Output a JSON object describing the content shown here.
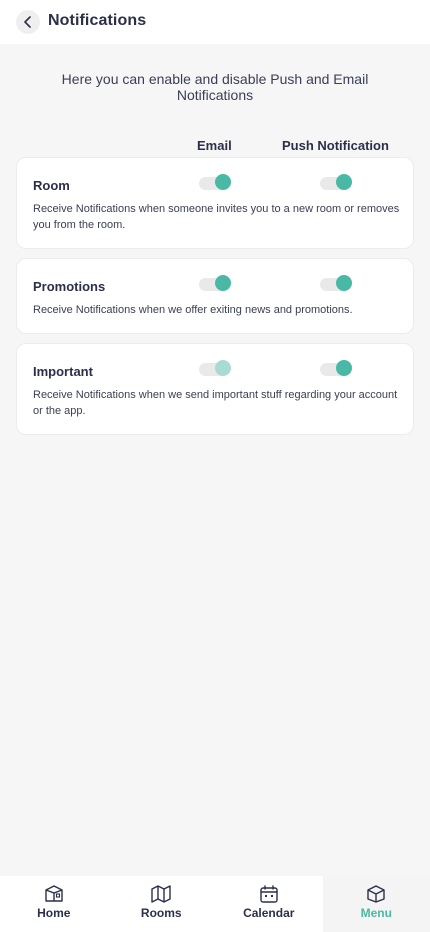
{
  "header": {
    "title": "Notifications",
    "back_icon": "chevron-left-icon"
  },
  "intro": "Here you can enable and disable Push and Email Notifications",
  "columns": {
    "email": "Email",
    "push": "Push Notification"
  },
  "settings": [
    {
      "title": "Room",
      "description": "Receive Notifications when someone invites you to a new room or removes you from the room.",
      "email_enabled": true,
      "push_enabled": true
    },
    {
      "title": "Promotions",
      "description": "Receive Notifications when we offer exiting news and promotions.",
      "email_enabled": true,
      "push_enabled": true
    },
    {
      "title": "Important",
      "description": "Receive Notifications when we send important stuff regarding your account or the app.",
      "email_enabled": true,
      "email_locked": true,
      "push_enabled": true
    }
  ],
  "nav": {
    "items": [
      {
        "label": "Home",
        "icon": "home-icon"
      },
      {
        "label": "Rooms",
        "icon": "rooms-icon"
      },
      {
        "label": "Calendar",
        "icon": "calendar-icon"
      },
      {
        "label": "Menu",
        "icon": "menu-icon"
      }
    ],
    "active": "Menu"
  },
  "colors": {
    "accent": "#49b9a5",
    "accent_dim": "#a8dcd3",
    "text": "#2b2f4a",
    "background": "#f6f6f6"
  }
}
